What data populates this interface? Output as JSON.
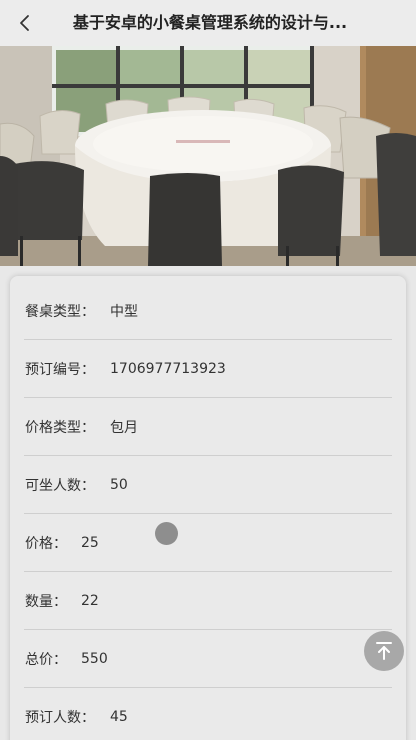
{
  "header": {
    "title": "基于安卓的小餐桌管理系统的设计与..."
  },
  "icons": {
    "back": "chevron-left-icon",
    "back_to_top": "arrow-up-to-top-icon"
  },
  "details": {
    "rows": [
      {
        "label": "餐桌类型：",
        "value": "中型"
      },
      {
        "label": "预订编号：",
        "value": "1706977713923"
      },
      {
        "label": "价格类型：",
        "value": "包月"
      },
      {
        "label": "可坐人数：",
        "value": "50"
      },
      {
        "label": "价格：",
        "value": "25"
      },
      {
        "label": "数量：",
        "value": "22"
      },
      {
        "label": "总价：",
        "value": "550"
      },
      {
        "label": "预订人数：",
        "value": "45"
      }
    ]
  },
  "colors": {
    "background": "#e8e8e8",
    "header_bg": "#ececec",
    "card_bg": "#eaeaea",
    "divider": "#cfcfcf",
    "fab": "#a8a8a8"
  }
}
